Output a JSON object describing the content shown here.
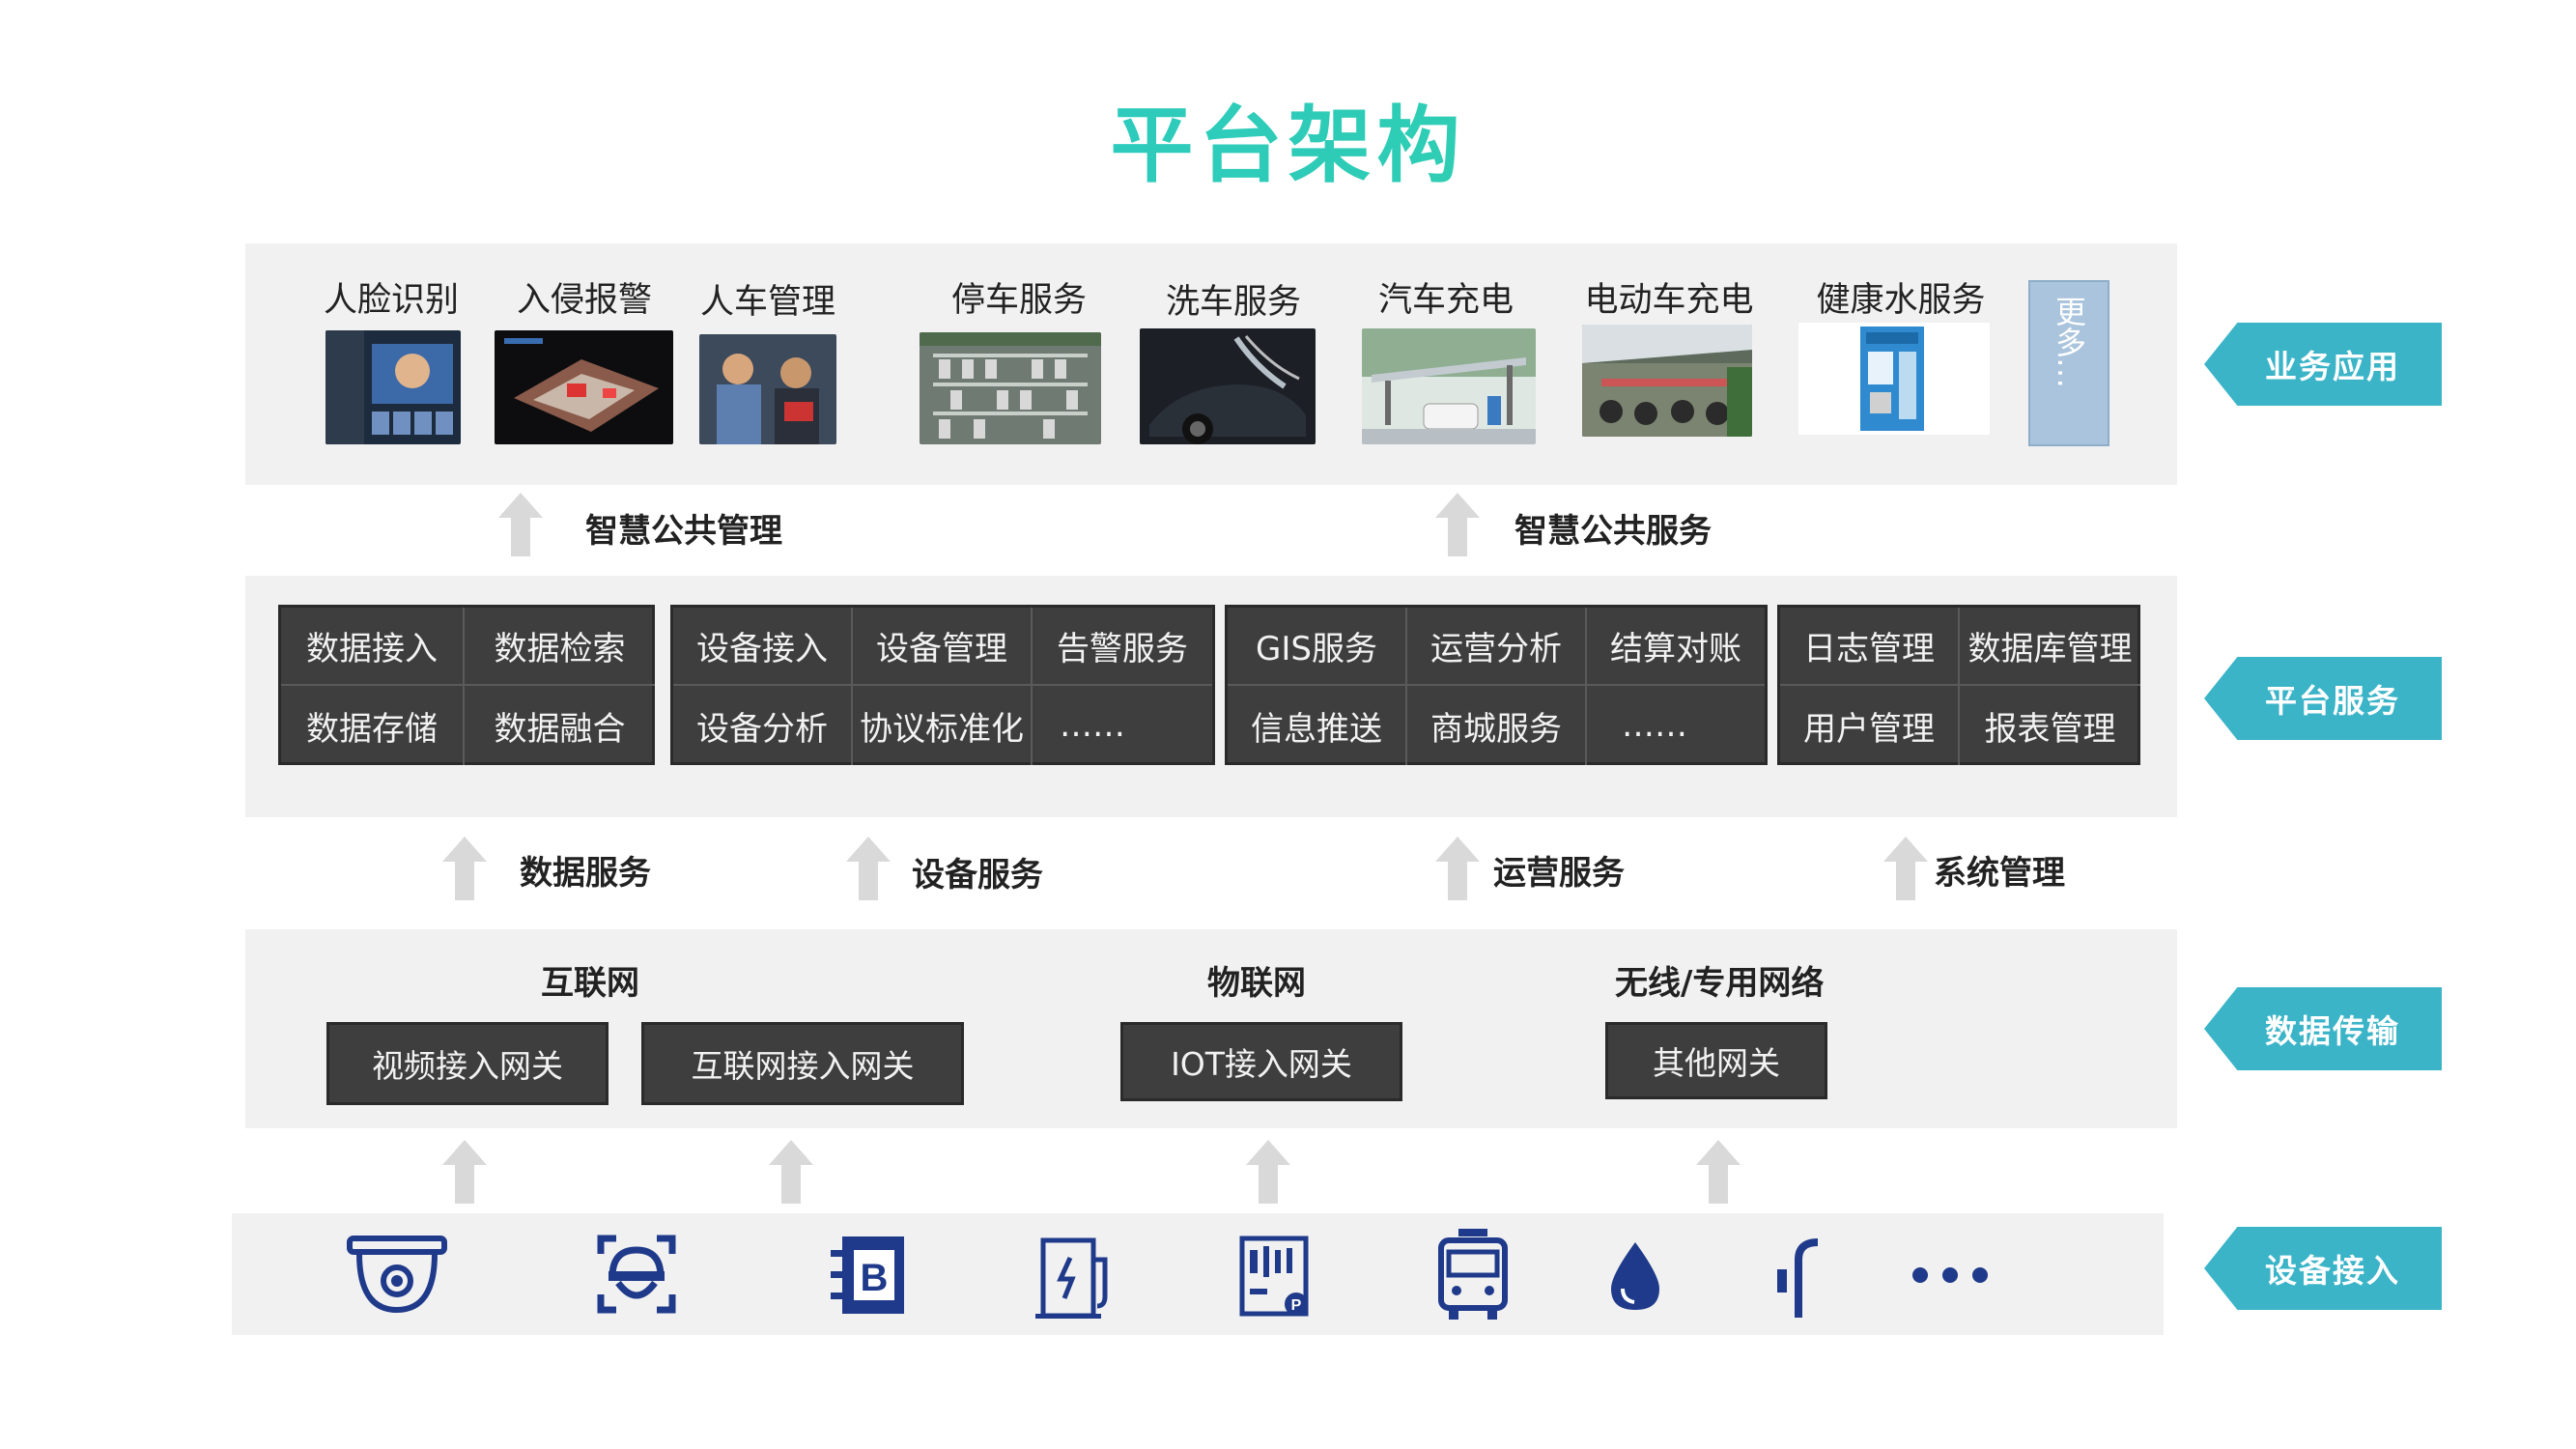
{
  "title": "平台架构",
  "colors": {
    "accent_start": "#29c4d6",
    "accent_end": "#33d49a",
    "tag": "#3bb4c8",
    "dark_cell": "#3e3e3e",
    "band": "#f1f1f1",
    "icon_blue": "#1f3a8a"
  },
  "apps": [
    {
      "label": "人脸识别",
      "image": "face-recognition-photo"
    },
    {
      "label": "入侵报警",
      "image": "intrusion-alarm-photo"
    },
    {
      "label": "人车管理",
      "image": "people-vehicle-photo"
    },
    {
      "label": "停车服务",
      "image": "parking-lot-photo"
    },
    {
      "label": "洗车服务",
      "image": "car-wash-photo"
    },
    {
      "label": "汽车充电",
      "image": "ev-charging-photo"
    },
    {
      "label": "电动车充电",
      "image": "ebike-charging-photo"
    },
    {
      "label": "健康水服务",
      "image": "water-kiosk-photo"
    }
  ],
  "more_label": "更多…",
  "flow_top": [
    "智慧公共管理",
    "智慧公共服务"
  ],
  "service_groups": [
    {
      "cells": [
        "数据接入",
        "数据检索",
        "数据存储",
        "数据融合"
      ]
    },
    {
      "cells": [
        "设备接入",
        "设备管理",
        "告警服务",
        "设备分析",
        "协议标准化",
        "……"
      ]
    },
    {
      "cells": [
        "GIS服务",
        "运营分析",
        "结算对账",
        "信息推送",
        "商城服务",
        "……"
      ]
    },
    {
      "cells": [
        "日志管理",
        "数据库管理",
        "用户管理",
        "报表管理"
      ]
    }
  ],
  "flow_mid": [
    "数据服务",
    "设备服务",
    "运营服务",
    "系统管理"
  ],
  "networks": [
    {
      "head": "互联网",
      "gateways": [
        "视频接入网关",
        "互联网接入网关"
      ]
    },
    {
      "head": "物联网",
      "gateways": [
        "IOT接入网关"
      ]
    },
    {
      "head": "无线/专用网络",
      "gateways": [
        "其他网关"
      ]
    }
  ],
  "devices": [
    "dome-camera-icon",
    "face-scan-icon",
    "bluetooth-gateway-icon",
    "charger-icon",
    "parking-meter-icon",
    "bus-icon",
    "water-drop-icon",
    "street-lamp-icon",
    "ellipsis-icon"
  ],
  "layer_tags": [
    "业务应用",
    "平台服务",
    "数据传输",
    "设备接入"
  ]
}
